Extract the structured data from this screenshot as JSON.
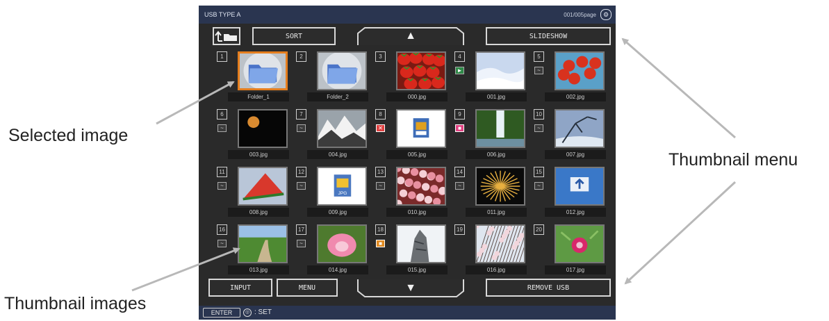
{
  "callouts": {
    "selected_image": "Selected image",
    "thumbnail_menu": "Thumbnail menu",
    "thumbnail_images": "Thumbnail images"
  },
  "screen": {
    "title": "USB TYPE A",
    "page_indicator": "001/005page",
    "top_buttons": {
      "sort": "SORT",
      "slideshow": "SLIDESHOW"
    },
    "bottom_buttons": {
      "input": "INPUT",
      "menu": "MENU",
      "remove_usb": "REMOVE USB"
    },
    "thumbnails": [
      {
        "num": "1",
        "name": "Folder_1",
        "type": "folder",
        "badge": "",
        "selected": true
      },
      {
        "num": "2",
        "name": "Folder_2",
        "type": "folder",
        "badge": "",
        "selected": false
      },
      {
        "num": "3",
        "name": "000.jpg",
        "type": "strawberries",
        "badge": "",
        "selected": false
      },
      {
        "num": "4",
        "name": "001.jpg",
        "type": "snow",
        "badge": "►",
        "selected": false
      },
      {
        "num": "5",
        "name": "002.jpg",
        "type": "redleaves",
        "badge": "~",
        "selected": false
      },
      {
        "num": "6",
        "name": "003.jpg",
        "type": "moon",
        "badge": "~",
        "selected": false
      },
      {
        "num": "7",
        "name": "004.jpg",
        "type": "mountain",
        "badge": "~",
        "selected": false
      },
      {
        "num": "8",
        "name": "005.jpg",
        "type": "imgicon",
        "badge": "✕",
        "selected": false
      },
      {
        "num": "9",
        "name": "006.jpg",
        "type": "waterfall",
        "badge": "■",
        "selected": false
      },
      {
        "num": "10",
        "name": "007.jpg",
        "type": "branches",
        "badge": "~",
        "selected": false
      },
      {
        "num": "11",
        "name": "008.jpg",
        "type": "watermelon",
        "badge": "~",
        "selected": false
      },
      {
        "num": "12",
        "name": "009.jpg",
        "type": "jpgicon",
        "badge": "~",
        "selected": false
      },
      {
        "num": "13",
        "name": "010.jpg",
        "type": "blossoms",
        "badge": "~",
        "selected": false
      },
      {
        "num": "14",
        "name": "011.jpg",
        "type": "fireworks",
        "badge": "~",
        "selected": false
      },
      {
        "num": "15",
        "name": "012.jpg",
        "type": "sign",
        "badge": "~",
        "selected": false
      },
      {
        "num": "16",
        "name": "013.jpg",
        "type": "path",
        "badge": "~",
        "selected": false
      },
      {
        "num": "17",
        "name": "014.jpg",
        "type": "lotus",
        "badge": "~",
        "selected": false
      },
      {
        "num": "18",
        "name": "015.jpg",
        "type": "tree",
        "badge": "■",
        "selected": false
      },
      {
        "num": "19",
        "name": "016.jpg",
        "type": "sakura",
        "badge": "",
        "selected": false
      },
      {
        "num": "20",
        "name": "017.jpg",
        "type": "flower",
        "badge": "",
        "selected": false
      }
    ],
    "status": {
      "enter": "ENTER",
      "set_text": ": SET"
    }
  },
  "colors": {
    "selection_border": "#e57e1e",
    "title_bar": "#2a3550",
    "screen_bg": "#2a2a2a"
  },
  "icons": {
    "up_folder": "up-folder-icon",
    "page_up": "up-triangle-icon",
    "page_down": "down-triangle-icon"
  }
}
